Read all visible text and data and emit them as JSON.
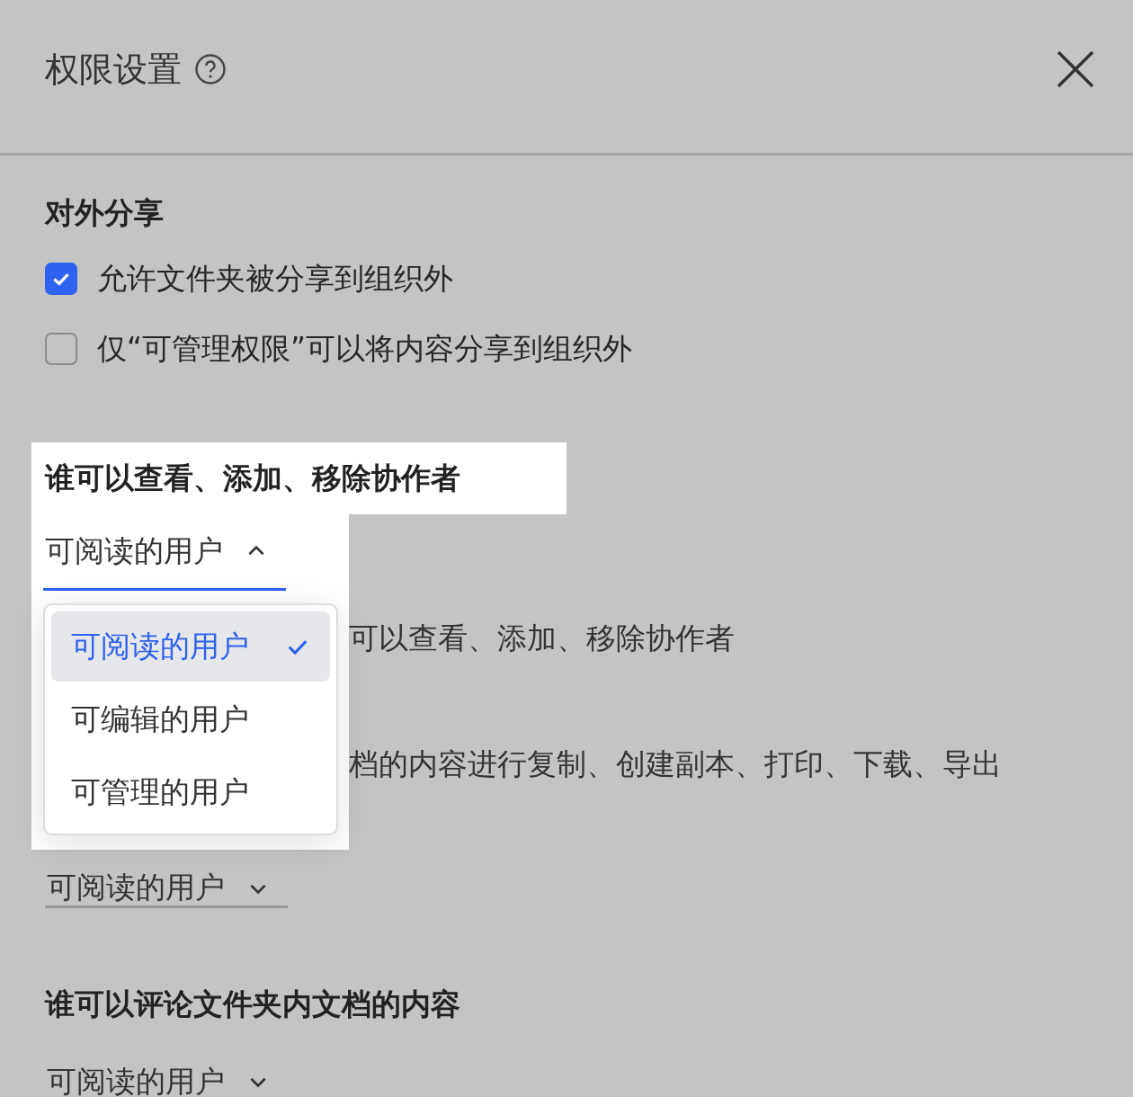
{
  "dialog": {
    "title": "权限设置"
  },
  "external_sharing": {
    "title": "对外分享",
    "options": [
      {
        "label": "允许文件夹被分享到组织外",
        "checked": true
      },
      {
        "label": "仅“可管理权限”可以将内容分享到组织外",
        "checked": false
      }
    ]
  },
  "collaborators": {
    "title": "谁可以查看、添加、移除协作者",
    "dropdown": {
      "value": "可阅读的用户",
      "expanded": true,
      "options": [
        {
          "label": "可阅读的用户",
          "selected": true
        },
        {
          "label": "可编辑的用户",
          "selected": false
        },
        {
          "label": "可管理的用户",
          "selected": false
        }
      ]
    }
  },
  "covered_texts": [
    "可以查看、添加、移除协作者",
    "档的内容进行复制、创建副本、打印、下载、导出"
  ],
  "copy_permission": {
    "dropdown": {
      "value": "可阅读的用户",
      "expanded": false
    }
  },
  "comment_permission": {
    "title": "谁可以评论文件夹内文档的内容",
    "dropdown": {
      "value": "可阅读的用户",
      "expanded": false
    }
  }
}
